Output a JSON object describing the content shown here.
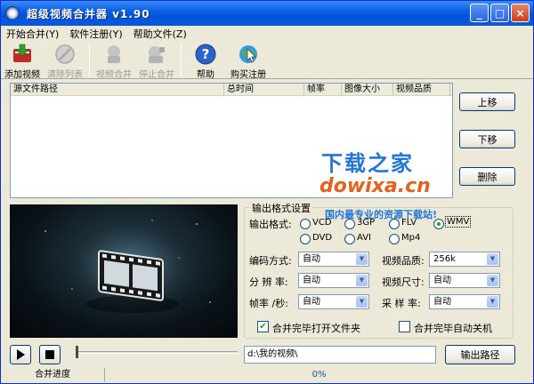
{
  "window": {
    "title": "超级视频合并器 v1.90",
    "controls": {
      "minimize": "_",
      "maximize": "□",
      "close": "×"
    }
  },
  "menu": [
    "开始合并(Y)",
    "软件注册(Y)",
    "帮助文件(Z)"
  ],
  "toolbar": {
    "add": "添加视频",
    "clear": "清除列表",
    "merge": "视频合并",
    "stop": "停止合并",
    "help": "帮助",
    "buy": "购买注册"
  },
  "filelist": {
    "columns": [
      "源文件路径",
      "总时间",
      "帧率",
      "图像大小",
      "视频品质"
    ]
  },
  "side_buttons": {
    "up": "上移",
    "down": "下移",
    "delete": "删除"
  },
  "output": {
    "group_title": "输出格式设置",
    "format_label": "输出格式:",
    "formats": [
      "VCD",
      "3GP",
      "FLV",
      "WMV",
      "DVD",
      "AVI",
      "Mp4"
    ],
    "selected_format": "WMV",
    "codec_label": "编码方式:",
    "codec_value": "自动",
    "quality_label": "视频品质:",
    "quality_value": "256k",
    "resolution_label": "分 辨 率:",
    "resolution_value": "自动",
    "size_label": "视频尺寸:",
    "size_value": "自动",
    "fps_label": "帧率 /秒:",
    "fps_value": "自动",
    "sample_label": "采 样 率:",
    "sample_value": "自动",
    "open_folder_label": "合并完毕打开文件夹",
    "open_folder_checked": true,
    "shutdown_label": "合并完毕自动关机",
    "shutdown_checked": false
  },
  "player": {
    "play_icon": "play-icon",
    "stop_icon": "stop-icon"
  },
  "path": {
    "value": "d:\\我的视频\\",
    "button": "输出路径"
  },
  "status": {
    "label": "合并进度",
    "progress": "0%"
  },
  "watermark": {
    "line1": "下载之家",
    "line2": "dowixa.cn",
    "line3": "国内最专业的资源下载站!"
  }
}
